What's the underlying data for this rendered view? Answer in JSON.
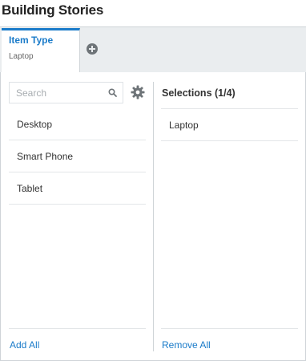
{
  "page": {
    "title": "Building Stories"
  },
  "tabs": [
    {
      "title": "Item Type",
      "subtitle": "Laptop",
      "active": true
    }
  ],
  "tabbar": {
    "add_icon": "plus-circle-icon"
  },
  "available": {
    "search_placeholder": "Search",
    "search_icon": "search-icon",
    "settings_icon": "gear-icon",
    "items": [
      "Desktop",
      "Smart Phone",
      "Tablet"
    ],
    "add_all_label": "Add All"
  },
  "selections": {
    "title": "Selections (1/4)",
    "items": [
      "Laptop"
    ],
    "remove_all_label": "Remove All"
  },
  "colors": {
    "accent": "#1a7bc9",
    "tabbar_bg": "#eaedef",
    "border": "#cfd4d8",
    "icon_gray": "#6e7478"
  }
}
